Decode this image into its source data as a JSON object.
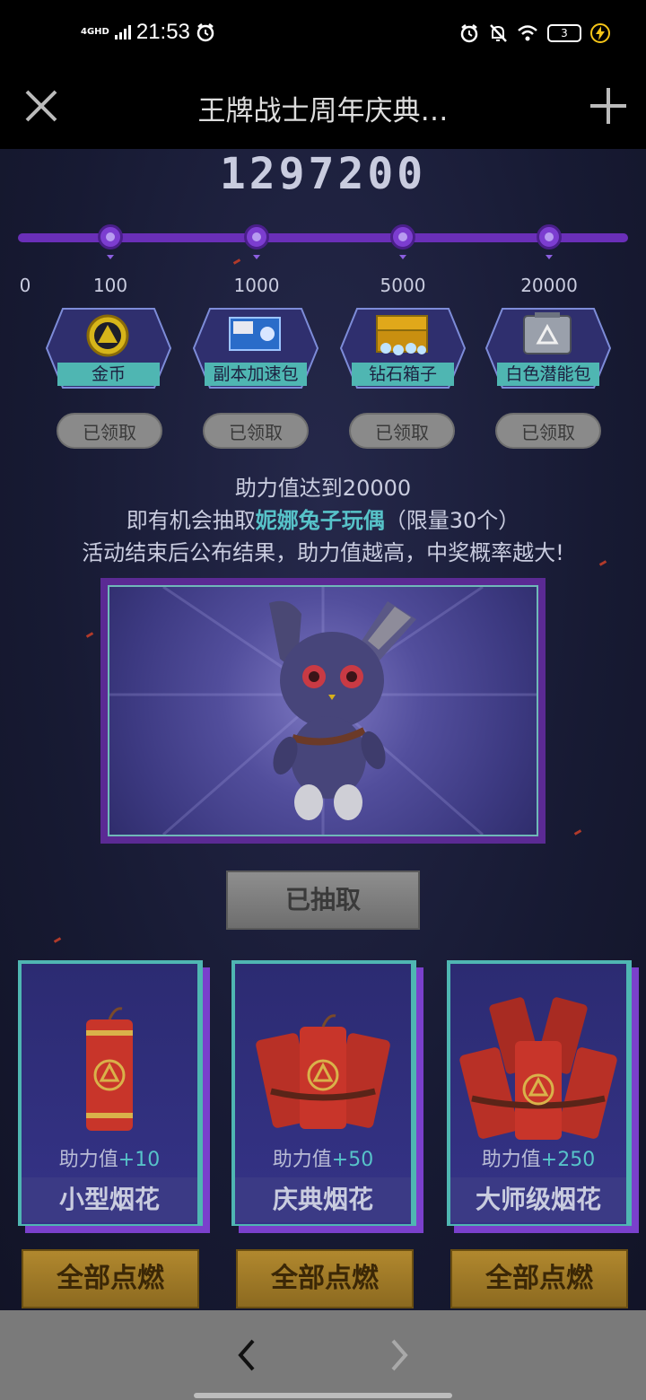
{
  "status_bar": {
    "network": "4GHD",
    "time": "21:53",
    "battery": "3"
  },
  "title_bar": {
    "title": "王牌战士周年庆典…"
  },
  "progress": {
    "total": "1297200",
    "milestones": [
      {
        "label": "0"
      },
      {
        "label": "100"
      },
      {
        "label": "1000"
      },
      {
        "label": "5000"
      },
      {
        "label": "20000"
      }
    ]
  },
  "rewards": [
    {
      "name": "金币",
      "status": "已领取"
    },
    {
      "name": "副本加速包",
      "status": "已领取"
    },
    {
      "name": "钻石箱子",
      "status": "已领取"
    },
    {
      "name": "白色潜能包",
      "status": "已领取"
    }
  ],
  "description": {
    "line1": "助力值达到20000",
    "line2_prefix": "即有机会抽取",
    "line2_highlight": "妮娜兔子玩偶",
    "line2_suffix": "（限量30个）",
    "line3": "活动结束后公布结果，助力值越高，中奖概率越大!"
  },
  "draw_button": "已抽取",
  "fireworks": [
    {
      "bonus_label": "助力值",
      "bonus_value": "+10",
      "name": "小型烟花",
      "button": "全部点燃"
    },
    {
      "bonus_label": "助力值",
      "bonus_value": "+50",
      "name": "庆典烟花",
      "button": "全部点燃"
    },
    {
      "bonus_label": "助力值",
      "bonus_value": "+250",
      "name": "大师级烟花",
      "button": "全部点燃"
    }
  ],
  "colors": {
    "accent_purple": "#6a2fb8",
    "accent_teal": "#4fb6b2",
    "highlight_text": "#57c3c9",
    "gold_button": "#b1882e"
  }
}
